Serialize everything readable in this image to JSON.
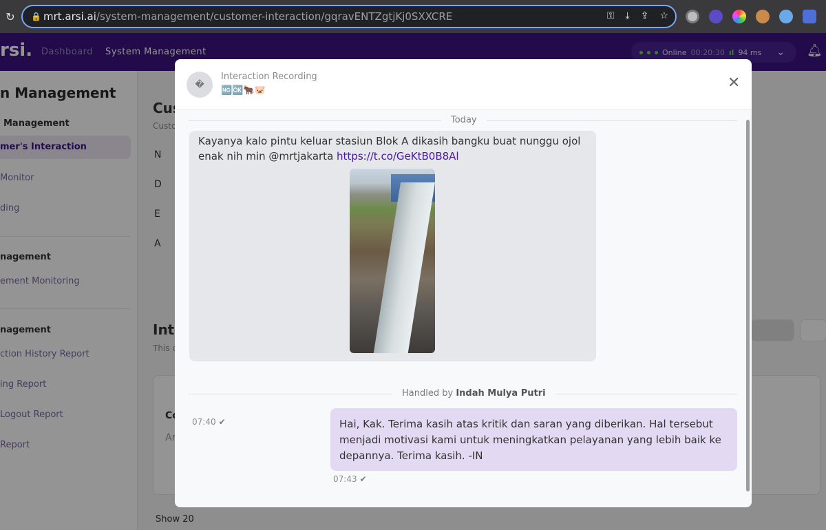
{
  "browser": {
    "url_domain": "mrt.arsi.ai",
    "url_path": "/system-management/customer-interaction/gqravENTZgtjKj0SXXCRE"
  },
  "header": {
    "logo": "rsi.",
    "nav": {
      "dashboard": "Dashboard",
      "system": "System Management"
    },
    "status": {
      "label": "Online",
      "timer": "00:20:30",
      "latency": "94 ms"
    }
  },
  "sidebar": {
    "title": "n Management",
    "sections": [
      {
        "head": "Management",
        "items": [
          "mer's Interaction",
          "Monitor",
          "ding"
        ]
      },
      {
        "head": "nagement",
        "items": [
          "ement Monitoring"
        ]
      },
      {
        "head": "nagement",
        "items": [
          "ction History Report",
          "ing Report",
          "Logout Report",
          "Report"
        ]
      }
    ]
  },
  "main_bg": {
    "title_fragment": "Cus",
    "sub_fragment": "Custo",
    "section_fragment": "Inte",
    "section_sub": "This c",
    "card_fragment": "Co",
    "card_sub": "Ar",
    "rows": [
      "N",
      "D",
      "E",
      "A"
    ],
    "show": "Show 20"
  },
  "modal": {
    "title": "Interaction Recording",
    "subtitle": "🆖🆗🐂🐷",
    "avatar": "�",
    "close_icon": "close-icon",
    "day_label": "Today",
    "incoming": {
      "text": "Kayanya kalo pintu keluar stasiun Blok A dikasih bangku buat nunggu ojol enak nih min @mrtjakarta ",
      "link": "https://t.co/GeKtB0B8Al",
      "time": "07:40"
    },
    "handled_prefix": "Handled by",
    "handled_name": "Indah Mulya Putri",
    "outgoing": {
      "text": "Hai, Kak. Terima kasih atas kritik dan saran yang diberikan. Hal tersebut menjadi motivasi kami untuk meningkatkan pelayanan yang lebih baik ke depannya. Terima kasih. -IN",
      "time": "07:43"
    }
  },
  "colors": {
    "brand": "#3c1281",
    "incoming_bubble": "#e6e7ea",
    "outgoing_bubble": "#e3d9f2",
    "link": "#4a17a0"
  }
}
